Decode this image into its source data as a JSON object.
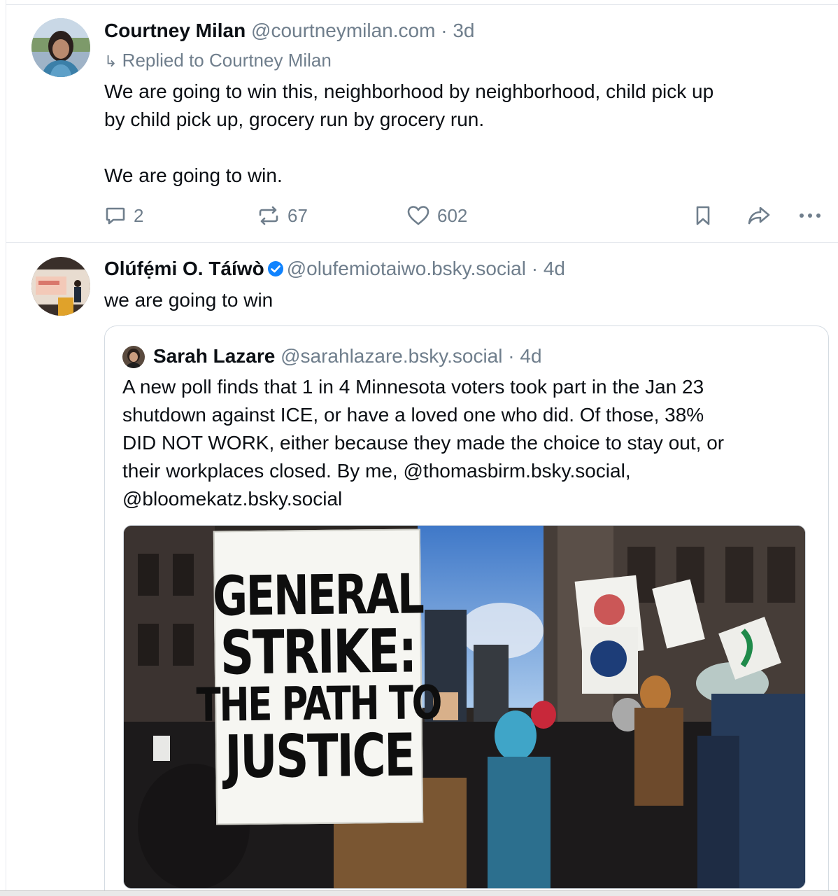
{
  "post1": {
    "author_name": "Courtney Milan",
    "author_handle": "@courtneymilan.com",
    "separator": "·",
    "age": "3d",
    "reply_arrow": "↳",
    "reply_to": "Replied to Courtney Milan",
    "text": "We are going to win this, neighborhood by neighborhood, child pick up\nby child pick up, grocery run by grocery run.\n\nWe are going to win.",
    "reply_count": "2",
    "repost_count": "67",
    "like_count": "602"
  },
  "post2": {
    "author_name": "Olúfẹ́mi O. Táíwò",
    "verified": true,
    "author_handle": "@olufemiotaiwo.bsky.social",
    "separator": "·",
    "age": "4d",
    "text": "we are going to win",
    "quote": {
      "author_name": "Sarah Lazare",
      "author_handle": "@sarahlazare.bsky.social",
      "separator": "·",
      "age": "4d",
      "text": "A new poll finds that 1 in 4 Minnesota voters took part in the Jan 23\nshutdown against ICE, or have a loved one who did. Of those, 38%\nDID NOT WORK, either because they made the choice to stay out, or\ntheir workplaces closed. By me, @thomasbirm.bsky.social,\n@bloomekatz.bsky.social",
      "image": {
        "sign_lines": [
          "GENERAL",
          "STRIKE:",
          "THE PATH TO",
          "JUSTICE"
        ]
      }
    }
  },
  "colors": {
    "text": "#0b0f14",
    "muted": "#6f7e8c",
    "verified": "#1083fe",
    "border": "#d4dbe2"
  },
  "icons": [
    "reply-icon",
    "repost-icon",
    "like-icon",
    "bookmark-icon",
    "share-icon",
    "more-icon",
    "verified-badge-icon"
  ]
}
